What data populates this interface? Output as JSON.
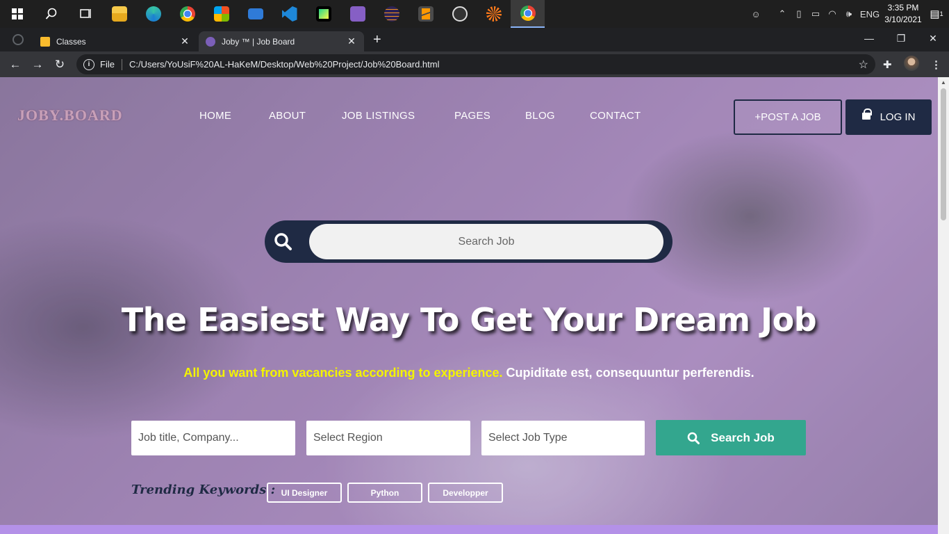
{
  "taskbar": {
    "apps": [
      "file-explorer",
      "edge",
      "chrome",
      "store",
      "mail",
      "vscode",
      "pycharm",
      "visual-studio",
      "eclipse",
      "sublime-text",
      "obs",
      "app-starburst",
      "chrome-active"
    ],
    "lang": "ENG",
    "time": "3:35 PM",
    "date": "3/10/2021",
    "notifications": "1"
  },
  "browser": {
    "tabs": [
      {
        "title": "Classes",
        "close": "✕"
      },
      {
        "title": "Joby ™ | Job Board",
        "close": "✕"
      }
    ],
    "new_tab": "+",
    "scheme": "File",
    "url": "C:/Users/YoUsiF%20AL-HaKeM/Desktop/Web%20Project/Job%20Board.html"
  },
  "site": {
    "logo": "JOBY.BOARD",
    "nav": [
      "HOME",
      "ABOUT",
      "JOB LISTINGS",
      "PAGES",
      "BLOG",
      "CONTACT"
    ],
    "post_job": "+POST A JOB",
    "login": "LOG IN",
    "search_placeholder": "Search Job",
    "hero_title": "The Easiest Way To Get Your Dream Job",
    "hero_sub_highlight": "All you want from vacancies according to experience.",
    "hero_sub_rest": " Cupiditate est, consequuntur perferendis.",
    "filters": {
      "job_title_placeholder": "Job title, Company...",
      "region": "Select Region",
      "job_type": "Select Job Type",
      "search_button": "Search Job"
    },
    "trending_label": "Trending Keywords :",
    "keywords": [
      "UI Designer",
      "Python",
      "Developper"
    ]
  },
  "colors": {
    "navy": "#1f2a44",
    "teal": "#33a68e",
    "highlight_yellow": "#f4f400",
    "logo_pink": "#c8a0b8",
    "strip": "#b491e8"
  }
}
